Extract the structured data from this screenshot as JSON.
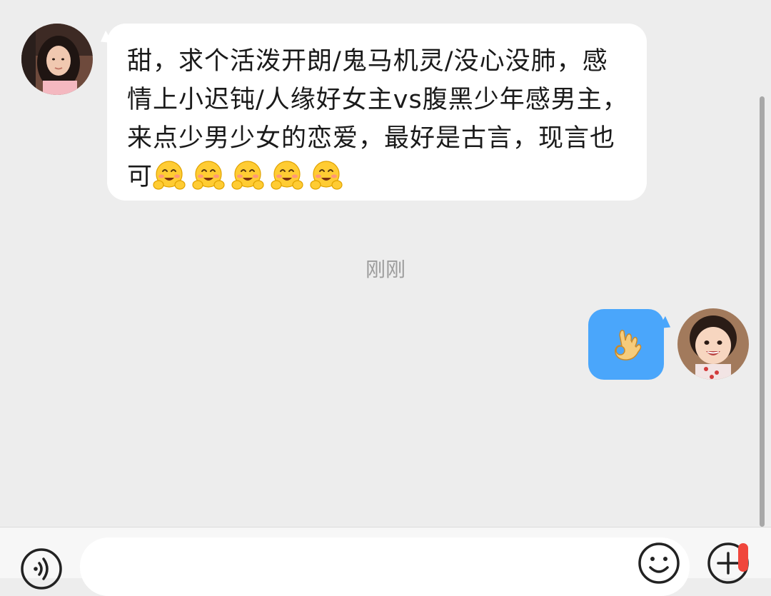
{
  "chat": {
    "incoming": {
      "text": "甜，求个活泼开朗/鬼马机灵/没心没肺，感情上小迟钝/人缘好女主vs腹黑少年感男主，来点少男少女的恋爱，最好是古言，现言也可",
      "emoji_name": "hugging-face-emoji",
      "emoji_count": 5
    },
    "timestamp": "刚刚",
    "outgoing": {
      "emoji_name": "ok-hand-emoji"
    }
  },
  "input_bar": {
    "placeholder": "",
    "voice_icon": "voice-icon",
    "emoji_icon": "emoji-icon",
    "plus_icon": "plus-icon"
  },
  "colors": {
    "background": "#ededed",
    "incoming_bubble": "#ffffff",
    "outgoing_bubble": "#4aa6fb",
    "timestamp_text": "#9c9c9c",
    "notify_dot": "#f0463c"
  }
}
